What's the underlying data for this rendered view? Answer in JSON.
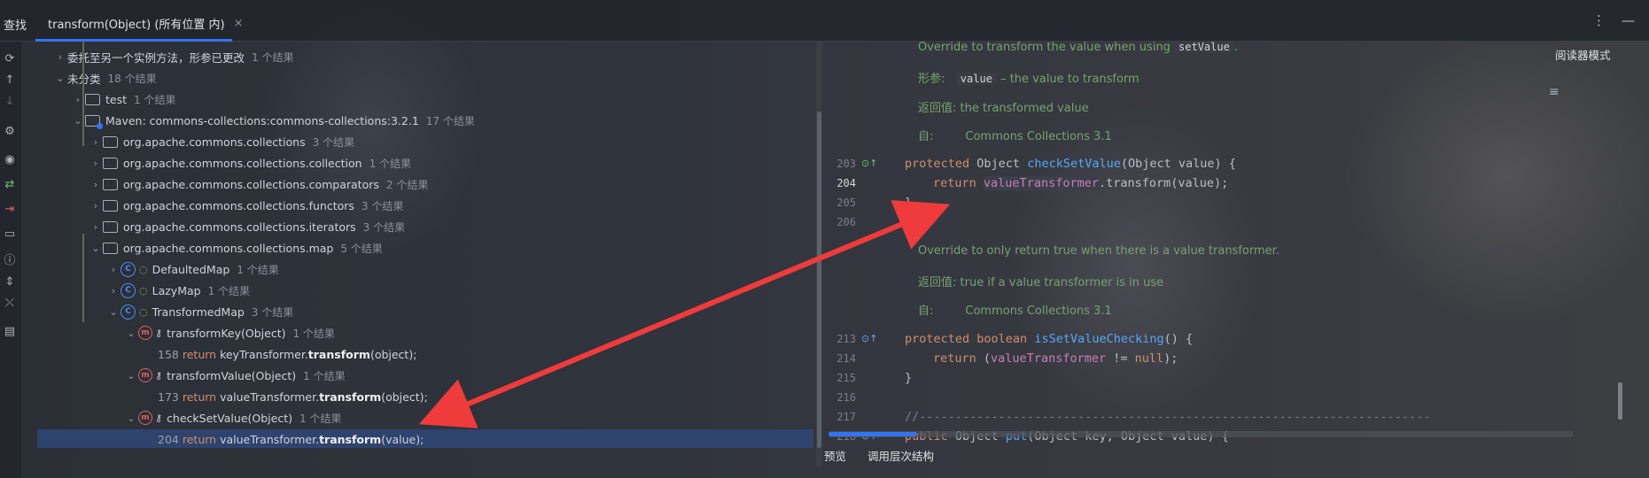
{
  "find_panel": {
    "title": "查找",
    "tab_label": "transform(Object) (所有位置 内)",
    "tab_close": "×",
    "menu_glyph": "⋮",
    "minimize_glyph": "—"
  },
  "toolbar_icons": [
    "rerun-icon",
    "arrow-up-icon",
    "arrow-down-icon",
    "settings-icon",
    "eye-icon",
    "navigate-icon",
    "exclude-icon",
    "folder-icon",
    "info-icon",
    "expand-icon",
    "collapse-icon",
    "preview-icon"
  ],
  "tree": {
    "rows": [
      {
        "text": "委托至另一个实例方法，形参已更改",
        "count": "1 个结果"
      },
      {
        "text": "未分类",
        "count": "18 个结果"
      },
      {
        "text": "test",
        "count": "1 个结果"
      },
      {
        "text": "Maven: commons-collections:commons-collections:3.2.1",
        "count": "17 个结果"
      },
      {
        "text": "org.apache.commons.collections",
        "count": "3 个结果"
      },
      {
        "text": "org.apache.commons.collections.collection",
        "count": "1 个结果"
      },
      {
        "text": "org.apache.commons.collections.comparators",
        "count": "2 个结果"
      },
      {
        "text": "org.apache.commons.collections.functors",
        "count": "3 个结果"
      },
      {
        "text": "org.apache.commons.collections.iterators",
        "count": "3 个结果"
      },
      {
        "text": "org.apache.commons.collections.map",
        "count": "5 个结果"
      },
      {
        "text": "DefaultedMap",
        "count": "1 个结果"
      },
      {
        "text": "LazyMap",
        "count": "1 个结果"
      },
      {
        "text": "TransformedMap",
        "count": "3 个结果"
      },
      {
        "text": "transformKey(Object)",
        "count": "1 个结果"
      },
      {
        "text": "transformValue(Object)",
        "count": "1 个结果"
      },
      {
        "text": "checkSetValue(Object)",
        "count": "1 个结果"
      }
    ],
    "usages": [
      {
        "line": "158",
        "kw": "return",
        "pre": "keyTransformer.",
        "bold": "transform",
        "post": "(object);"
      },
      {
        "line": "173",
        "kw": "return",
        "pre": "valueTransformer.",
        "bold": "transform",
        "post": "(object);"
      },
      {
        "line": "204",
        "kw": "return",
        "pre": "valueTransformer.",
        "bold": "transform",
        "post": "(value);"
      }
    ]
  },
  "editor": {
    "reader_mode": "阅读器模式",
    "doc1": {
      "line1_pre": "Override to transform the value when using",
      "line1_code": "setValue",
      "line1_post": ".",
      "param_label": "形参:",
      "param_code": "value",
      "param_desc": "– the value to transform",
      "return_label": "返回值:",
      "return_desc": "the transformed value",
      "since_label": "自:",
      "since_desc": "Commons Collections 3.1"
    },
    "doc2": {
      "line1": "Override to only return true when there is a value transformer.",
      "return_label": "返回值:",
      "return_desc": "true if a value transformer is in use",
      "since_label": "自:",
      "since_desc": "Commons Collections 3.1"
    },
    "gutter": [
      "203",
      "204",
      "205",
      "206",
      "213",
      "214",
      "215",
      "216",
      "217",
      "218"
    ],
    "code": {
      "l203_a": "protected",
      "l203_b": " Object ",
      "l203_fn": "checkSetValue",
      "l203_c": "(Object value) {",
      "l204_kw": "return",
      "l204_field": "valueTransformer",
      "l204_rest": ".transform(value);",
      "l205": "}",
      "l213_a": "protected boolean",
      "l213_fn": "isSetValueChecking",
      "l213_c": "() {",
      "l214_kw": "return",
      "l214_field": "valueTransformer",
      "l214_rest": " != ",
      "l214_null": "null",
      "l214_end": ");",
      "l215": "}",
      "l217": "//-----------------------------------------------------------------------",
      "l218_a": "public",
      "l218_b": " Object ",
      "l218_fn": "put",
      "l218_c": "(Object key, Object value) {"
    },
    "bottom_tabs": [
      "预览",
      "调用层次结构"
    ]
  },
  "colors": {
    "accent": "#3574f0",
    "arrow": "#ef3b3b",
    "selection": "#2e436e"
  }
}
